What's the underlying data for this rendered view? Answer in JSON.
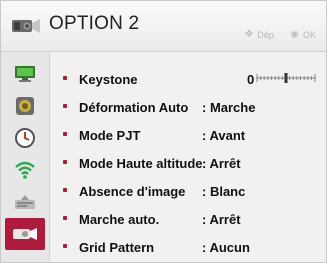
{
  "header": {
    "title": "OPTION 2",
    "nav_hint_move": "Dép.",
    "nav_hint_ok": "OK"
  },
  "sidebar": {
    "items": [
      {
        "icon": "monitor-icon",
        "active": false
      },
      {
        "icon": "speaker-icon",
        "active": false
      },
      {
        "icon": "clock-icon",
        "active": false
      },
      {
        "icon": "wifi-icon",
        "active": false
      },
      {
        "icon": "option1-icon",
        "active": false
      },
      {
        "icon": "projector-icon",
        "active": true
      }
    ]
  },
  "menu": {
    "keystone": {
      "label": "Keystone",
      "value": "0",
      "slider_level": 0.5
    },
    "items": [
      {
        "label": "Déformation Auto",
        "value": ": Marche"
      },
      {
        "label": "Mode PJT",
        "value": ": Avant"
      },
      {
        "label": "Mode Haute altitude",
        "value": ": Arrêt"
      },
      {
        "label": "Absence d'image",
        "value": ": Blanc"
      },
      {
        "label": "Marche auto.",
        "value": ": Arrêt"
      },
      {
        "label": "Grid Pattern",
        "value": ": Aucun"
      }
    ]
  },
  "colors": {
    "accent": "#b01a3c",
    "text": "#111111",
    "background": "#f1f1f1"
  }
}
